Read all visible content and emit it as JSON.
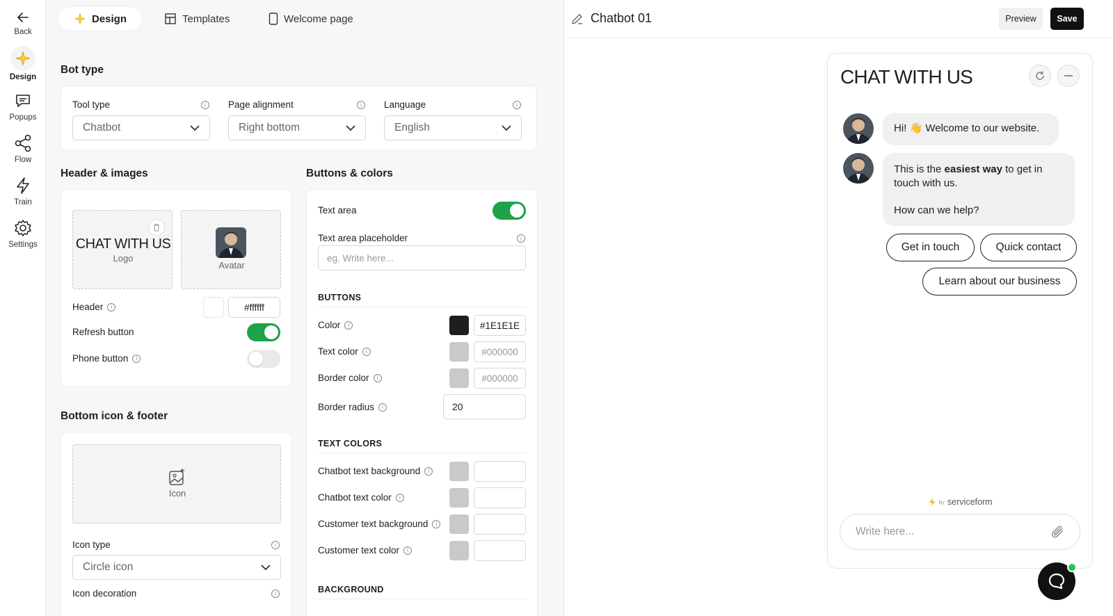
{
  "nav": {
    "back": "Back",
    "items": [
      {
        "label": "Design",
        "icon": "sparkle-icon"
      },
      {
        "label": "Popups",
        "icon": "chat-icon"
      },
      {
        "label": "Flow",
        "icon": "share-icon"
      },
      {
        "label": "Train",
        "icon": "bolt-icon"
      },
      {
        "label": "Settings",
        "icon": "gear-icon"
      }
    ]
  },
  "tabs": {
    "design": "Design",
    "templates": "Templates",
    "welcome": "Welcome page"
  },
  "bot_type": {
    "title": "Bot type",
    "tool_type": {
      "label": "Tool type",
      "value": "Chatbot"
    },
    "page_alignment": {
      "label": "Page alignment",
      "value": "Right bottom"
    },
    "language": {
      "label": "Language",
      "value": "English"
    }
  },
  "header_images": {
    "title": "Header & images",
    "logo_text": "CHAT WITH US",
    "logo_caption": "Logo",
    "avatar_caption": "Avatar",
    "header_label": "Header",
    "header_color": "#ffffff",
    "refresh_label": "Refresh button",
    "refresh_on": true,
    "phone_label": "Phone button",
    "phone_on": false
  },
  "buttons_colors": {
    "title": "Buttons & colors",
    "text_area_label": "Text area",
    "text_area_on": true,
    "placeholder_label": "Text area placeholder",
    "placeholder_hint": "eg. Write here...",
    "buttons_heading": "BUTTONS",
    "color_label": "Color",
    "color_value": "#1E1E1E",
    "text_color_label": "Text color",
    "text_color_value": "#000000",
    "border_color_label": "Border color",
    "border_color_value": "#000000",
    "border_radius_label": "Border radius",
    "border_radius_value": "20",
    "text_colors_heading": "TEXT COLORS",
    "chatbot_bg_label": "Chatbot text background",
    "chatbot_text_label": "Chatbot text color",
    "customer_bg_label": "Customer text background",
    "customer_text_label": "Customer text color",
    "background_heading": "BACKGROUND"
  },
  "bottom_footer": {
    "title": "Bottom icon & footer",
    "icon_caption": "Icon",
    "icon_type_label": "Icon type",
    "icon_type_value": "Circle icon",
    "icon_decoration_label": "Icon decoration"
  },
  "preview": {
    "bot_name": "Chatbot 01",
    "preview_btn": "Preview",
    "save_btn": "Save",
    "chat_title": "CHAT WITH US",
    "msg1_pre": "Hi! ",
    "msg1_emoji": "👋",
    "msg1_post": " Welcome to our website.",
    "msg2_pre": "This is the ",
    "msg2_bold": "easiest way",
    "msg2_post": " to get in touch with us.",
    "msg2_line2": "How can we help?",
    "quick_replies": [
      "Get in touch",
      "Quick contact",
      "Learn about our business"
    ],
    "powered_by": "by",
    "brand": "serviceform",
    "input_placeholder": "Write here..."
  }
}
